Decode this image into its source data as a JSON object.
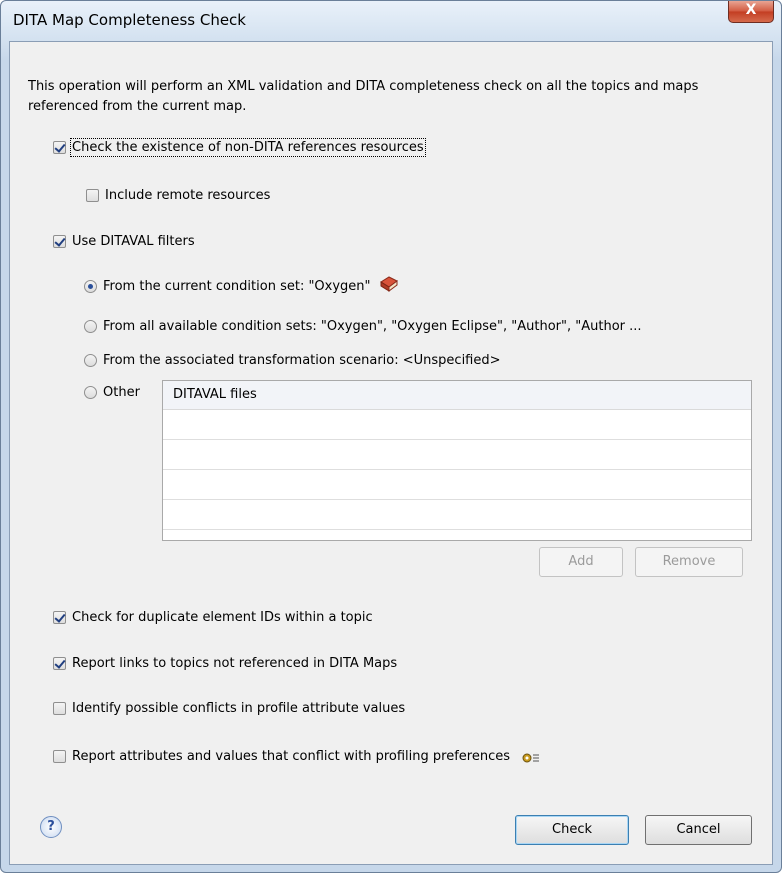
{
  "window": {
    "title": "DITA Map Completeness Check",
    "close_glyph": "X"
  },
  "intro": "This operation will perform an XML validation and DITA completeness check on all the topics and maps referenced from the current map.",
  "options": {
    "check_non_dita": {
      "label": "Check the existence of non-DITA references resources",
      "checked": true
    },
    "include_remote": {
      "label": "Include remote resources",
      "checked": false
    },
    "use_ditaval": {
      "label": "Use DITAVAL filters",
      "checked": true
    }
  },
  "ditaval_sources": {
    "current_condition": {
      "label": "From the current condition set: \"Oxygen\"",
      "selected": true,
      "icon": "book-icon"
    },
    "all_conditions": {
      "label": "From all available condition sets: \"Oxygen\", \"Oxygen Eclipse\", \"Author\", \"Author  ...",
      "selected": false
    },
    "transformation": {
      "label": "From the associated transformation scenario: <Unspecified>",
      "selected": false
    },
    "other": {
      "label": "Other",
      "selected": false
    }
  },
  "ditaval_table": {
    "header": "DITAVAL files",
    "rows": [
      "",
      "",
      "",
      ""
    ]
  },
  "table_buttons": {
    "add": "Add",
    "remove": "Remove"
  },
  "checks": {
    "duplicate_ids": {
      "label": "Check for duplicate element IDs within a topic",
      "checked": true
    },
    "unreferenced_topics": {
      "label": "Report links to topics not referenced in DITA Maps",
      "checked": true
    },
    "profile_conflicts": {
      "label": "Identify possible conflicts in profile attribute values",
      "checked": false
    },
    "profiling_prefs": {
      "label": "Report attributes and values that conflict with profiling preferences",
      "checked": false,
      "icon": "gear-settings-icon"
    }
  },
  "footer": {
    "help": "?",
    "check": "Check",
    "cancel": "Cancel"
  }
}
